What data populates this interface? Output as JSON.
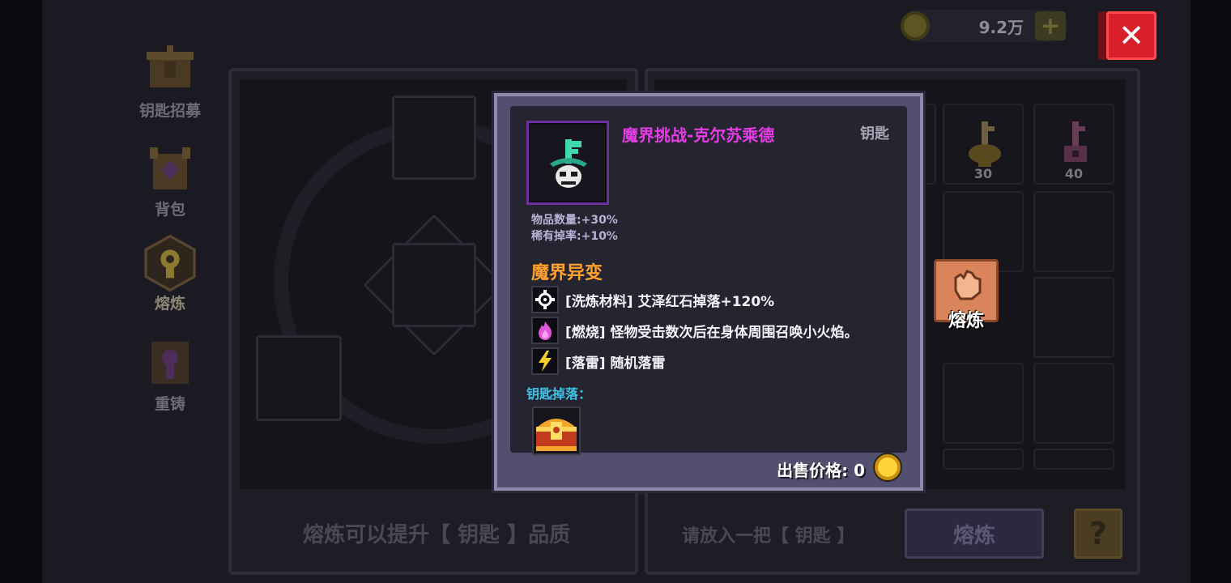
{
  "header": {
    "coins": "9.2万",
    "add_label": "+",
    "close_label": "✕"
  },
  "nav": {
    "items": [
      {
        "label": "钥匙招募",
        "icon": "chest-recruit-icon"
      },
      {
        "label": "背包",
        "icon": "backpack-icon"
      },
      {
        "label": "熔炼",
        "icon": "smelt-key-icon",
        "active": true
      },
      {
        "label": "重铸",
        "icon": "recast-icon"
      }
    ]
  },
  "left_panel": {
    "hint": "熔炼可以提升【 钥匙 】品质"
  },
  "right_panel": {
    "keys": [
      {
        "count": "30",
        "icon": "gold-key-icon"
      },
      {
        "count": "40",
        "icon": "pink-key-icon"
      }
    ],
    "float_smelt_label": "熔炼",
    "placeholder": "请放入一把【 钥匙 】",
    "smelt_button": "熔炼",
    "help_label": "?"
  },
  "tooltip": {
    "title": "魔界挑战-克尔苏乘德",
    "type": "钥匙",
    "stats": [
      "物品数量:+30%",
      "稀有掉率:+10%"
    ],
    "section_title": "魔界异变",
    "effects": [
      {
        "icon": "gear-icon",
        "text": "[洗炼材料] 艾泽红石掉落+120%"
      },
      {
        "icon": "flame-icon",
        "text": "[燃烧] 怪物受击数次后在身体周围召唤小火焰。"
      },
      {
        "icon": "lightning-icon",
        "text": "[落雷] 随机落雷"
      }
    ],
    "drop_title": "钥匙掉落：",
    "sell_price": "出售价格: 0"
  },
  "colors": {
    "title_magenta": "#e63ce8",
    "section_orange": "#ffa12f",
    "drop_cyan": "#3fc3e6",
    "close_red": "#d9202a"
  }
}
